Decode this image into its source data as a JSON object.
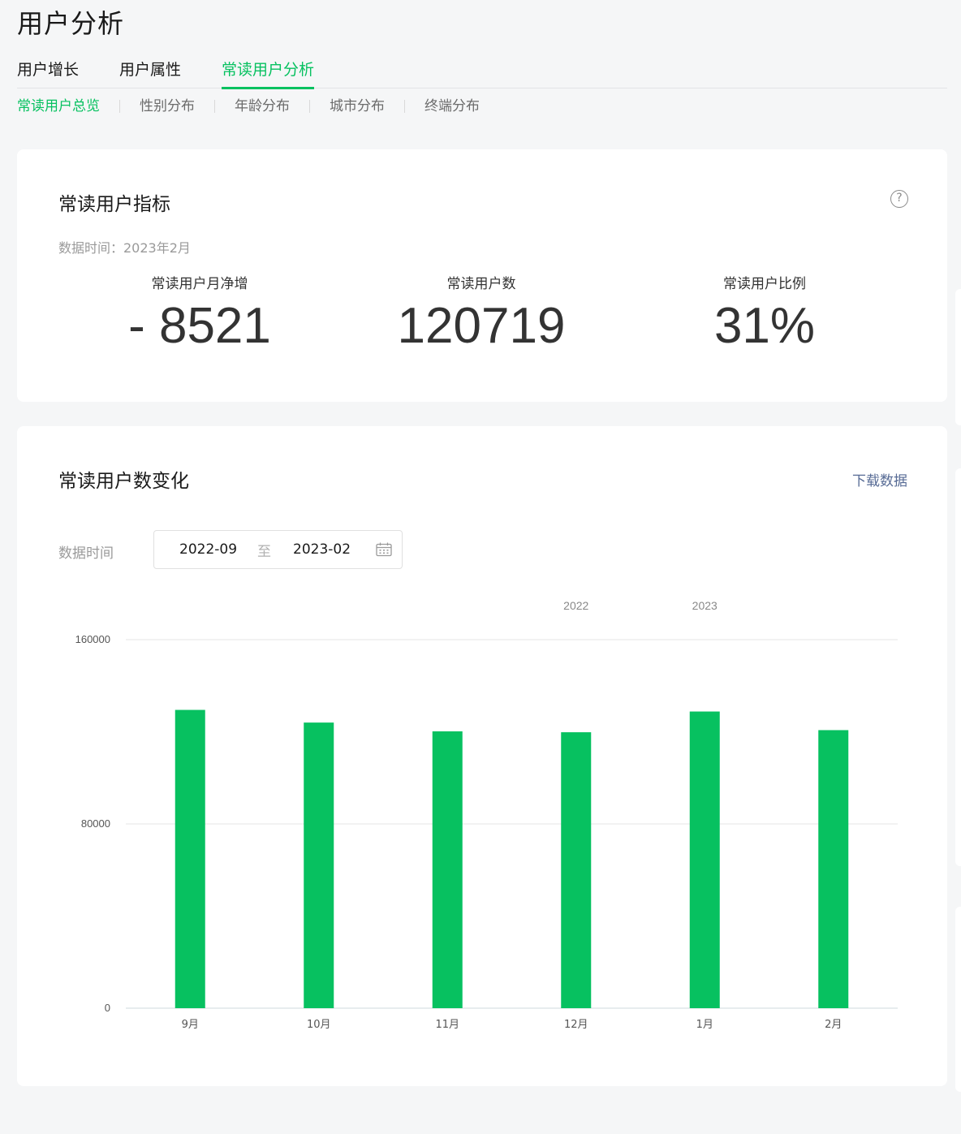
{
  "page": {
    "title": "用户分析"
  },
  "tabs": [
    {
      "label": "用户增长",
      "active": false
    },
    {
      "label": "用户属性",
      "active": false
    },
    {
      "label": "常读用户分析",
      "active": true
    }
  ],
  "subtabs": [
    {
      "label": "常读用户总览",
      "active": true
    },
    {
      "label": "性别分布",
      "active": false
    },
    {
      "label": "年龄分布",
      "active": false
    },
    {
      "label": "城市分布",
      "active": false
    },
    {
      "label": "终端分布",
      "active": false
    }
  ],
  "metrics_card": {
    "title": "常读用户指标",
    "help_icon": "question-circle-icon",
    "data_time": "数据时间：2023年2月",
    "metrics": [
      {
        "label": "常读用户月净增",
        "value": "- 8521"
      },
      {
        "label": "常读用户数",
        "value": "120719"
      },
      {
        "label": "常读用户比例",
        "value": "31%"
      }
    ]
  },
  "trend_card": {
    "title": "常读用户数变化",
    "download_label": "下载数据",
    "range_label": "数据时间",
    "range_start": "2022-09",
    "range_separator": "至",
    "range_end": "2023-02",
    "calendar_icon": "calendar-icon"
  },
  "colors": {
    "accent": "#07c160",
    "link": "#576b95",
    "bar": "#07c160"
  },
  "chart_data": {
    "type": "bar",
    "categories": [
      "9月",
      "10月",
      "11月",
      "12月",
      "1月",
      "2月"
    ],
    "year_labels": [
      {
        "label": "2022",
        "category_index": 3
      },
      {
        "label": "2023",
        "category_index": 4
      }
    ],
    "values": [
      129500,
      124000,
      120200,
      119800,
      128800,
      120719
    ],
    "yticks": [
      0,
      80000,
      160000
    ],
    "ylim": [
      0,
      160000
    ],
    "grid": true,
    "title": "",
    "xlabel": "",
    "ylabel": ""
  }
}
